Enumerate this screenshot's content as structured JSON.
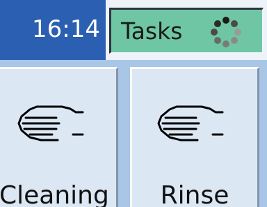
{
  "header": {
    "clock": "16:14",
    "tasks_button": {
      "label": "Tasks",
      "icon": "loading-spinner-icon"
    }
  },
  "programs": [
    {
      "label": "Cleaning",
      "icon": "hand-icon"
    },
    {
      "label": "Rinse",
      "icon": "hand-icon"
    }
  ],
  "colors": {
    "clock_bg": "#2b5fb2",
    "tasks_bg": "#6fc6a4",
    "panel_bg": "#a9c6e7",
    "tile_bg": "#dce7f4"
  }
}
